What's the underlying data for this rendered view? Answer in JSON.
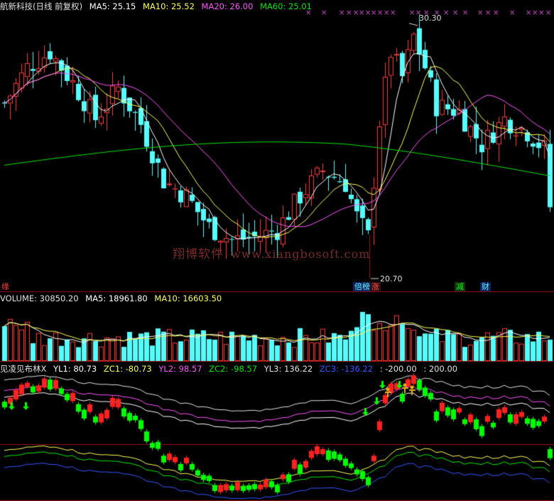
{
  "colors": {
    "background": "#000000",
    "up": "#ff3b3b",
    "down": "#54fcfc",
    "ma5": "#ffffff",
    "ma10": "#ffff54",
    "ma20": "#ff54ff",
    "ma60": "#00e600",
    "ind_up": "#ff2020",
    "ind_down": "#00ff00",
    "divider": "#a01010",
    "zc3": "#3355ff"
  },
  "main": {
    "title": "航新科技(日线 前复权)",
    "ma5_label": "MA5: 25.15",
    "ma10_label": "MA10: 25.52",
    "ma20_label": "MA20: 26.00",
    "ma60_label": "MA60: 25.01",
    "high_label": "30.30",
    "low_label": "20.70",
    "left_marker": "缘",
    "tags": [
      {
        "text": "倍榜",
        "color": "#54fcfc",
        "bg": "#102060"
      },
      {
        "text": "涨",
        "color": "#ff5050",
        "bg": "#301010"
      },
      {
        "text": "减",
        "color": "#00ff00",
        "bg": "#103010"
      },
      {
        "text": "财",
        "color": "#54fcfc",
        "bg": "#102060"
      }
    ]
  },
  "volume": {
    "label": "VOLUME: 30850.20",
    "ma5_label": "MA5: 18961.80",
    "ma10_label": "MA10: 16603.50"
  },
  "indicator": {
    "name": "见凌见布林X",
    "yl1": "YL1: 80.73",
    "zc1": "ZC1: -80.73",
    "yl2": "YL2: 98.57",
    "zc2": "ZC2: -98.57",
    "yl3": "YL3: 136.22",
    "zc3": "ZC3: -136.22",
    "v1": ": -200.00",
    "v2": ": 200.00"
  },
  "watermark": {
    "cn": "翔博软件",
    "url": "www.xiangbosoft.com"
  }
}
